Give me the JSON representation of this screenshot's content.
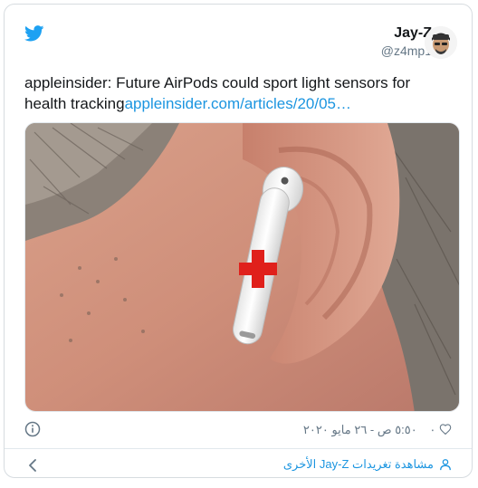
{
  "tweet": {
    "display_name": "Jay-Z",
    "handle": "@z4mp1",
    "text_prefix": "appleinsider: Future AirPods could sport light sensors for health tracking",
    "link_text": "appleinsider.com/articles/20/05…",
    "like_count": "٠",
    "timestamp": "٥:٥٠ ص - ٢٦ مايو ٢٠٢٠",
    "footer_link": "مشاهدة تغريدات Jay-Z الأخرى"
  },
  "colors": {
    "twitter_blue": "#1da1f2",
    "link_blue": "#1b95e0",
    "meta_gray": "#657786",
    "red_cross": "#e0201b"
  },
  "icons": {
    "logo": "twitter-bird-icon",
    "info": "info-icon",
    "like": "heart-icon",
    "footer": "person-icon",
    "back": "chevron-left-icon"
  }
}
